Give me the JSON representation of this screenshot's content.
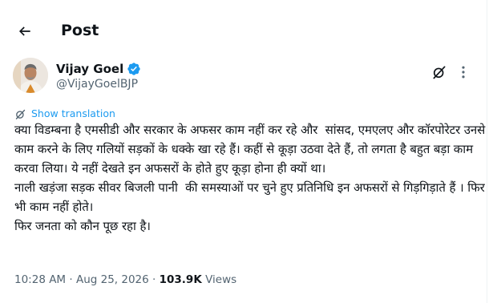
{
  "header": {
    "title": "Post",
    "back_icon": "arrow-left-icon"
  },
  "author": {
    "name": "Vijay Goel",
    "handle": "@VijayGoelBJP",
    "verified": true,
    "verified_color": "#1d9bf0"
  },
  "actions": {
    "grok_icon": "grok-slash-icon",
    "more_icon": "more-vertical-icon"
  },
  "translation": {
    "label": "Show translation",
    "icon": "translate-icon",
    "color": "#1d9bf0"
  },
  "tweet": {
    "text": "क्या विडम्बना है एमसीडी और सरकार के अफसर काम नहीं कर रहे और  सांसद, एमएलए और कॉरपोरेटर उनसे काम करने के लिए गलियों सड़कों के धक्के खा रहे हैं। कहीं से कूड़ा उठवा देते हैं, तो लगता है बहुत बड़ा काम करवा लिया। ये नहीं देखते इन अफसरों के होते हुए कूड़ा होना ही क्यों था।\nनाली खड़ंजा सड़क सीवर बिजली पानी  की समस्याओं पर चुने हुए प्रतिनिधि इन अफसरों से गिड़गिड़ाते हैं । फिर भी काम नहीं होते।\nफिर जनता को कौन पूछ रहा है।"
  },
  "meta": {
    "time": "10:28 AM",
    "separator": " · ",
    "date": "Aug 25, 2026",
    "views_count": "103.9K",
    "views_label": " Views"
  }
}
